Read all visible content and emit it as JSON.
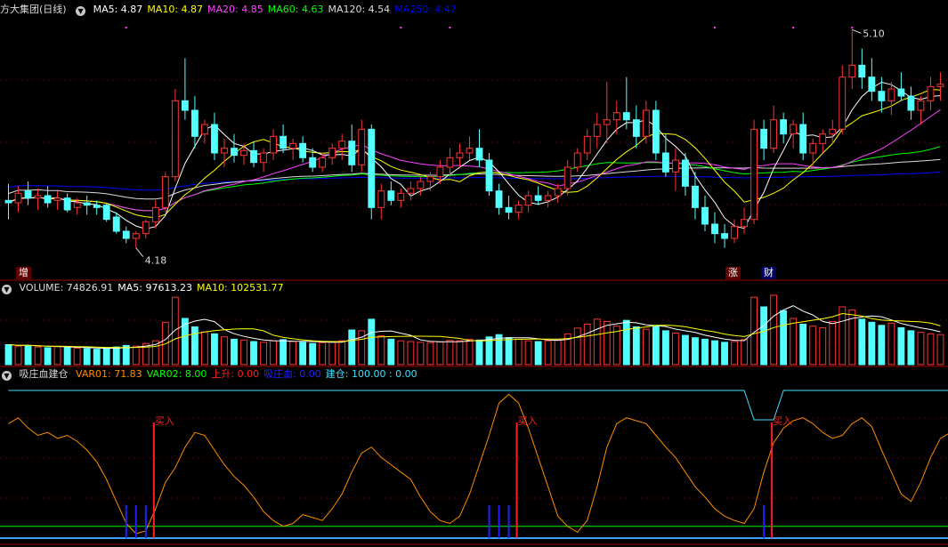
{
  "stock": {
    "name": "方大集团",
    "period": "(日线)"
  },
  "price_panel": {
    "ma_labels": [
      {
        "text": "MA5: 4.87",
        "color": "#ffffff"
      },
      {
        "text": "MA10: 4.87",
        "color": "#ffff00"
      },
      {
        "text": "MA20: 4.85",
        "color": "#ff40ff"
      },
      {
        "text": "MA60: 4.63",
        "color": "#00ff00"
      },
      {
        "text": "MA120: 4.54",
        "color": "#dcdcdc"
      },
      {
        "text": "MA250: 4.47",
        "color": "#0000ff"
      }
    ],
    "high_label": "5.10",
    "low_label": "4.18",
    "tags": [
      "增",
      "涨",
      "财"
    ]
  },
  "volume_panel": {
    "labels": [
      {
        "text": "VOLUME: 74826.91",
        "color": "#dcdcdc"
      },
      {
        "text": "MA5: 97613.23",
        "color": "#ffffff"
      },
      {
        "text": "MA10: 102531.77",
        "color": "#ffff00"
      }
    ]
  },
  "indicator_panel": {
    "title": "吸庄血建仓",
    "labels": [
      {
        "text": "VAR01: 71.83",
        "color": "#ff8c00"
      },
      {
        "text": "VAR02: 8.00",
        "color": "#00ff00"
      },
      {
        "text": "上升: 0.00",
        "color": "#ff2020"
      },
      {
        "text": "吸庄血: 0.00",
        "color": "#2020ff"
      },
      {
        "text": "建仓: 100.00 : 0.00",
        "color": "#40e0ff"
      }
    ],
    "buy_label": "买入"
  },
  "chart_data": {
    "type": "candlestick",
    "price_range": [
      4.1,
      5.15
    ],
    "candles": [
      {
        "o": 4.38,
        "h": 4.45,
        "l": 4.3,
        "c": 4.37
      },
      {
        "o": 4.37,
        "h": 4.44,
        "l": 4.33,
        "c": 4.41
      },
      {
        "o": 4.42,
        "h": 4.46,
        "l": 4.36,
        "c": 4.39
      },
      {
        "o": 4.39,
        "h": 4.43,
        "l": 4.34,
        "c": 4.4
      },
      {
        "o": 4.4,
        "h": 4.44,
        "l": 4.35,
        "c": 4.37
      },
      {
        "o": 4.38,
        "h": 4.42,
        "l": 4.34,
        "c": 4.39
      },
      {
        "o": 4.39,
        "h": 4.41,
        "l": 4.33,
        "c": 4.34
      },
      {
        "o": 4.35,
        "h": 4.39,
        "l": 4.32,
        "c": 4.37
      },
      {
        "o": 4.37,
        "h": 4.4,
        "l": 4.32,
        "c": 4.36
      },
      {
        "o": 4.36,
        "h": 4.38,
        "l": 4.32,
        "c": 4.35
      },
      {
        "o": 4.36,
        "h": 4.37,
        "l": 4.29,
        "c": 4.3
      },
      {
        "o": 4.31,
        "h": 4.33,
        "l": 4.24,
        "c": 4.25
      },
      {
        "o": 4.25,
        "h": 4.27,
        "l": 4.2,
        "c": 4.22
      },
      {
        "o": 4.22,
        "h": 4.25,
        "l": 4.18,
        "c": 4.24
      },
      {
        "o": 4.24,
        "h": 4.3,
        "l": 4.22,
        "c": 4.29
      },
      {
        "o": 4.29,
        "h": 4.38,
        "l": 4.26,
        "c": 4.35
      },
      {
        "o": 4.35,
        "h": 4.5,
        "l": 4.33,
        "c": 4.48
      },
      {
        "o": 4.48,
        "h": 4.85,
        "l": 4.46,
        "c": 4.8
      },
      {
        "o": 4.8,
        "h": 4.98,
        "l": 4.72,
        "c": 4.76
      },
      {
        "o": 4.76,
        "h": 4.82,
        "l": 4.6,
        "c": 4.65
      },
      {
        "o": 4.66,
        "h": 4.72,
        "l": 4.62,
        "c": 4.7
      },
      {
        "o": 4.7,
        "h": 4.75,
        "l": 4.55,
        "c": 4.58
      },
      {
        "o": 4.58,
        "h": 4.64,
        "l": 4.52,
        "c": 4.6
      },
      {
        "o": 4.6,
        "h": 4.66,
        "l": 4.54,
        "c": 4.57
      },
      {
        "o": 4.57,
        "h": 4.62,
        "l": 4.53,
        "c": 4.59
      },
      {
        "o": 4.59,
        "h": 4.63,
        "l": 4.52,
        "c": 4.54
      },
      {
        "o": 4.54,
        "h": 4.6,
        "l": 4.5,
        "c": 4.58
      },
      {
        "o": 4.58,
        "h": 4.68,
        "l": 4.55,
        "c": 4.65
      },
      {
        "o": 4.65,
        "h": 4.7,
        "l": 4.58,
        "c": 4.6
      },
      {
        "o": 4.6,
        "h": 4.64,
        "l": 4.55,
        "c": 4.62
      },
      {
        "o": 4.62,
        "h": 4.65,
        "l": 4.54,
        "c": 4.56
      },
      {
        "o": 4.56,
        "h": 4.6,
        "l": 4.5,
        "c": 4.52
      },
      {
        "o": 4.52,
        "h": 4.58,
        "l": 4.5,
        "c": 4.56
      },
      {
        "o": 4.56,
        "h": 4.62,
        "l": 4.53,
        "c": 4.6
      },
      {
        "o": 4.6,
        "h": 4.66,
        "l": 4.55,
        "c": 4.63
      },
      {
        "o": 4.63,
        "h": 4.7,
        "l": 4.5,
        "c": 4.53
      },
      {
        "o": 4.53,
        "h": 4.72,
        "l": 4.5,
        "c": 4.68
      },
      {
        "o": 4.68,
        "h": 4.7,
        "l": 4.3,
        "c": 4.35
      },
      {
        "o": 4.35,
        "h": 4.45,
        "l": 4.3,
        "c": 4.42
      },
      {
        "o": 4.42,
        "h": 4.46,
        "l": 4.36,
        "c": 4.38
      },
      {
        "o": 4.38,
        "h": 4.43,
        "l": 4.35,
        "c": 4.41
      },
      {
        "o": 4.41,
        "h": 4.46,
        "l": 4.38,
        "c": 4.43
      },
      {
        "o": 4.43,
        "h": 4.48,
        "l": 4.4,
        "c": 4.46
      },
      {
        "o": 4.46,
        "h": 4.5,
        "l": 4.42,
        "c": 4.48
      },
      {
        "o": 4.48,
        "h": 4.55,
        "l": 4.45,
        "c": 4.52
      },
      {
        "o": 4.52,
        "h": 4.6,
        "l": 4.48,
        "c": 4.56
      },
      {
        "o": 4.56,
        "h": 4.62,
        "l": 4.52,
        "c": 4.58
      },
      {
        "o": 4.58,
        "h": 4.65,
        "l": 4.55,
        "c": 4.6
      },
      {
        "o": 4.6,
        "h": 4.68,
        "l": 4.52,
        "c": 4.55
      },
      {
        "o": 4.55,
        "h": 4.58,
        "l": 4.4,
        "c": 4.42
      },
      {
        "o": 4.42,
        "h": 4.45,
        "l": 4.32,
        "c": 4.35
      },
      {
        "o": 4.35,
        "h": 4.4,
        "l": 4.3,
        "c": 4.33
      },
      {
        "o": 4.33,
        "h": 4.38,
        "l": 4.3,
        "c": 4.36
      },
      {
        "o": 4.36,
        "h": 4.42,
        "l": 4.33,
        "c": 4.4
      },
      {
        "o": 4.4,
        "h": 4.44,
        "l": 4.36,
        "c": 4.38
      },
      {
        "o": 4.38,
        "h": 4.42,
        "l": 4.35,
        "c": 4.4
      },
      {
        "o": 4.4,
        "h": 4.45,
        "l": 4.37,
        "c": 4.43
      },
      {
        "o": 4.43,
        "h": 4.55,
        "l": 4.4,
        "c": 4.52
      },
      {
        "o": 4.52,
        "h": 4.6,
        "l": 4.5,
        "c": 4.58
      },
      {
        "o": 4.58,
        "h": 4.68,
        "l": 4.55,
        "c": 4.65
      },
      {
        "o": 4.65,
        "h": 4.75,
        "l": 4.6,
        "c": 4.7
      },
      {
        "o": 4.7,
        "h": 4.88,
        "l": 4.62,
        "c": 4.72
      },
      {
        "o": 4.72,
        "h": 4.8,
        "l": 4.66,
        "c": 4.75
      },
      {
        "o": 4.75,
        "h": 4.9,
        "l": 4.68,
        "c": 4.72
      },
      {
        "o": 4.72,
        "h": 4.78,
        "l": 4.6,
        "c": 4.65
      },
      {
        "o": 4.65,
        "h": 4.8,
        "l": 4.62,
        "c": 4.76
      },
      {
        "o": 4.76,
        "h": 4.8,
        "l": 4.55,
        "c": 4.58
      },
      {
        "o": 4.58,
        "h": 4.66,
        "l": 4.48,
        "c": 4.5
      },
      {
        "o": 4.5,
        "h": 4.6,
        "l": 4.42,
        "c": 4.55
      },
      {
        "o": 4.55,
        "h": 4.58,
        "l": 4.4,
        "c": 4.44
      },
      {
        "o": 4.44,
        "h": 4.5,
        "l": 4.3,
        "c": 4.35
      },
      {
        "o": 4.35,
        "h": 4.4,
        "l": 4.25,
        "c": 4.28
      },
      {
        "o": 4.28,
        "h": 4.33,
        "l": 4.2,
        "c": 4.24
      },
      {
        "o": 4.24,
        "h": 4.28,
        "l": 4.18,
        "c": 4.22
      },
      {
        "o": 4.22,
        "h": 4.3,
        "l": 4.2,
        "c": 4.27
      },
      {
        "o": 4.27,
        "h": 4.35,
        "l": 4.24,
        "c": 4.3
      },
      {
        "o": 4.3,
        "h": 4.72,
        "l": 4.28,
        "c": 4.68
      },
      {
        "o": 4.68,
        "h": 4.72,
        "l": 4.55,
        "c": 4.6
      },
      {
        "o": 4.6,
        "h": 4.78,
        "l": 4.58,
        "c": 4.72
      },
      {
        "o": 4.72,
        "h": 4.75,
        "l": 4.62,
        "c": 4.66
      },
      {
        "o": 4.66,
        "h": 4.72,
        "l": 4.6,
        "c": 4.7
      },
      {
        "o": 4.7,
        "h": 4.75,
        "l": 4.55,
        "c": 4.58
      },
      {
        "o": 4.58,
        "h": 4.64,
        "l": 4.52,
        "c": 4.62
      },
      {
        "o": 4.62,
        "h": 4.68,
        "l": 4.58,
        "c": 4.66
      },
      {
        "o": 4.66,
        "h": 4.72,
        "l": 4.62,
        "c": 4.68
      },
      {
        "o": 4.68,
        "h": 4.95,
        "l": 4.66,
        "c": 4.9
      },
      {
        "o": 4.9,
        "h": 5.1,
        "l": 4.85,
        "c": 4.95
      },
      {
        "o": 4.95,
        "h": 5.02,
        "l": 4.85,
        "c": 4.9
      },
      {
        "o": 4.9,
        "h": 4.98,
        "l": 4.8,
        "c": 4.84
      },
      {
        "o": 4.84,
        "h": 4.9,
        "l": 4.75,
        "c": 4.8
      },
      {
        "o": 4.8,
        "h": 4.88,
        "l": 4.74,
        "c": 4.85
      },
      {
        "o": 4.85,
        "h": 4.92,
        "l": 4.8,
        "c": 4.82
      },
      {
        "o": 4.82,
        "h": 4.86,
        "l": 4.72,
        "c": 4.76
      },
      {
        "o": 4.76,
        "h": 4.82,
        "l": 4.7,
        "c": 4.8
      },
      {
        "o": 4.8,
        "h": 4.9,
        "l": 4.76,
        "c": 4.86
      },
      {
        "o": 4.86,
        "h": 4.92,
        "l": 4.8,
        "c": 4.87
      }
    ],
    "volume": [
      52,
      48,
      50,
      46,
      44,
      47,
      45,
      43,
      42,
      40,
      42,
      46,
      50,
      48,
      55,
      62,
      110,
      175,
      120,
      98,
      85,
      80,
      72,
      66,
      64,
      60,
      58,
      62,
      65,
      60,
      58,
      55,
      57,
      60,
      62,
      90,
      88,
      118,
      75,
      66,
      62,
      60,
      58,
      57,
      59,
      63,
      62,
      66,
      64,
      72,
      78,
      70,
      66,
      62,
      60,
      62,
      64,
      80,
      95,
      105,
      118,
      112,
      100,
      115,
      98,
      92,
      102,
      88,
      82,
      76,
      70,
      66,
      62,
      58,
      60,
      65,
      175,
      150,
      180,
      140,
      120,
      105,
      100,
      96,
      112,
      150,
      142,
      118,
      110,
      102,
      108,
      96,
      88,
      84,
      80,
      78
    ],
    "indicator": [
      78,
      82,
      75,
      70,
      72,
      68,
      70,
      66,
      60,
      52,
      40,
      25,
      10,
      3,
      5,
      20,
      38,
      48,
      62,
      72,
      70,
      60,
      50,
      42,
      36,
      28,
      18,
      12,
      8,
      10,
      16,
      14,
      12,
      20,
      30,
      45,
      58,
      62,
      55,
      50,
      45,
      40,
      28,
      18,
      12,
      10,
      15,
      30,
      50,
      70,
      92,
      98,
      92,
      75,
      55,
      35,
      15,
      8,
      4,
      12,
      35,
      62,
      78,
      82,
      80,
      78,
      70,
      62,
      55,
      45,
      35,
      28,
      20,
      15,
      12,
      10,
      20,
      45,
      65,
      75,
      80,
      82,
      78,
      72,
      68,
      70,
      78,
      82,
      76,
      60,
      45,
      30,
      25,
      38,
      55,
      68,
      71.83
    ],
    "var02": 8,
    "jiancang": [
      100,
      100,
      100,
      100,
      100,
      100,
      100,
      100,
      100,
      100,
      100,
      100,
      100,
      100,
      100,
      100,
      100,
      100,
      100,
      100,
      100,
      100,
      100,
      100,
      100,
      100,
      100,
      100,
      100,
      100,
      100,
      100,
      100,
      100,
      100,
      100,
      100,
      100,
      100,
      100,
      100,
      100,
      100,
      100,
      100,
      100,
      100,
      100,
      100,
      100,
      100,
      100,
      100,
      100,
      100,
      100,
      100,
      100,
      100,
      100,
      100,
      100,
      100,
      100,
      100,
      100,
      100,
      100,
      100,
      100,
      100,
      100,
      100,
      100,
      100,
      100,
      70,
      70,
      70,
      100,
      100,
      100,
      100,
      100,
      100,
      100,
      100,
      100,
      100,
      100,
      100,
      100,
      100,
      100,
      100,
      100,
      100
    ],
    "buy_signals": [
      15,
      52,
      78
    ],
    "xizhuang_signals": [
      12,
      13,
      14,
      49,
      50,
      51,
      77
    ]
  }
}
